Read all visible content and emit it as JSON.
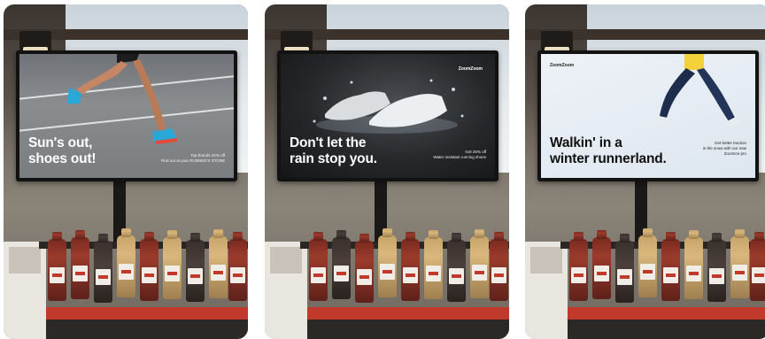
{
  "panels": [
    {
      "headline_line1": "Sun's out,",
      "headline_line2": "shoes out!",
      "small_line1": "Top brands 20% off",
      "small_line2": "Find out at your RUNNER'S STORE",
      "brand": ""
    },
    {
      "headline_line1": "Don't let the",
      "headline_line2": "rain stop you.",
      "small_line1": "Get 25% off",
      "small_line2": "Water resistant running shoes",
      "brand": "ZoomZoom"
    },
    {
      "headline_line1": "Walkin' in a",
      "headline_line2": "winter runnerland.",
      "small_line1": "Get better traction",
      "small_line2": "in the snow with our new ZoomIce pro",
      "brand": "ZoomZoom"
    }
  ],
  "colors": {
    "tray": "#c0392b",
    "frame": "#121212"
  }
}
